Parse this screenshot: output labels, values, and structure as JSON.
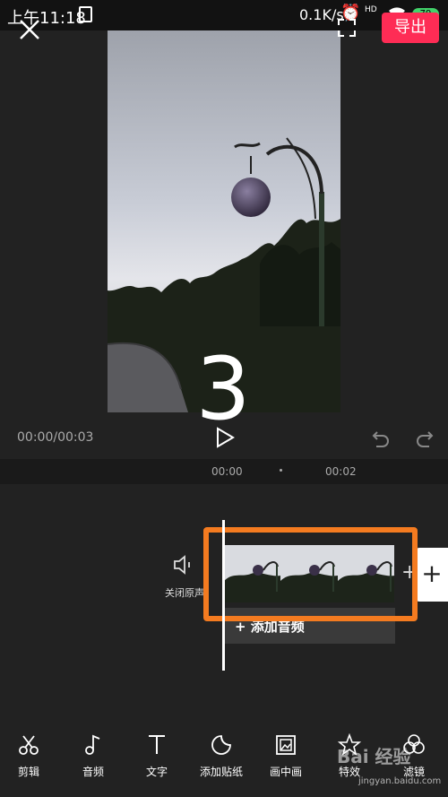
{
  "status_bar": {
    "time": "上午11:18",
    "network_speed": "0.1K/s",
    "network_badge": "HD",
    "battery": "79"
  },
  "top_bar": {
    "export_label": "导出"
  },
  "preview": {
    "countdown": "3"
  },
  "playback": {
    "time_readout": "00:00/00:03"
  },
  "ruler": {
    "ticks": [
      "00:00",
      "00:02"
    ]
  },
  "timeline": {
    "mute_label": "关闭原声",
    "add_clip_symbol": "+",
    "add_audio_label": "+ 添加音频"
  },
  "toolbar": {
    "items": [
      {
        "label": "剪辑",
        "icon": "scissors-icon"
      },
      {
        "label": "音频",
        "icon": "music-note-icon"
      },
      {
        "label": "文字",
        "icon": "text-icon"
      },
      {
        "label": "添加贴纸",
        "icon": "sticker-icon"
      },
      {
        "label": "画中画",
        "icon": "picture-in-picture-icon"
      },
      {
        "label": "特效",
        "icon": "effects-star-icon"
      },
      {
        "label": "滤镜",
        "icon": "filter-icon"
      }
    ]
  },
  "watermark": {
    "text": "Bai 经验",
    "url": "jingyan.baidu.com"
  },
  "colors": {
    "accent": "#fe2c55",
    "highlight": "#f47b20",
    "background": "#222222"
  }
}
